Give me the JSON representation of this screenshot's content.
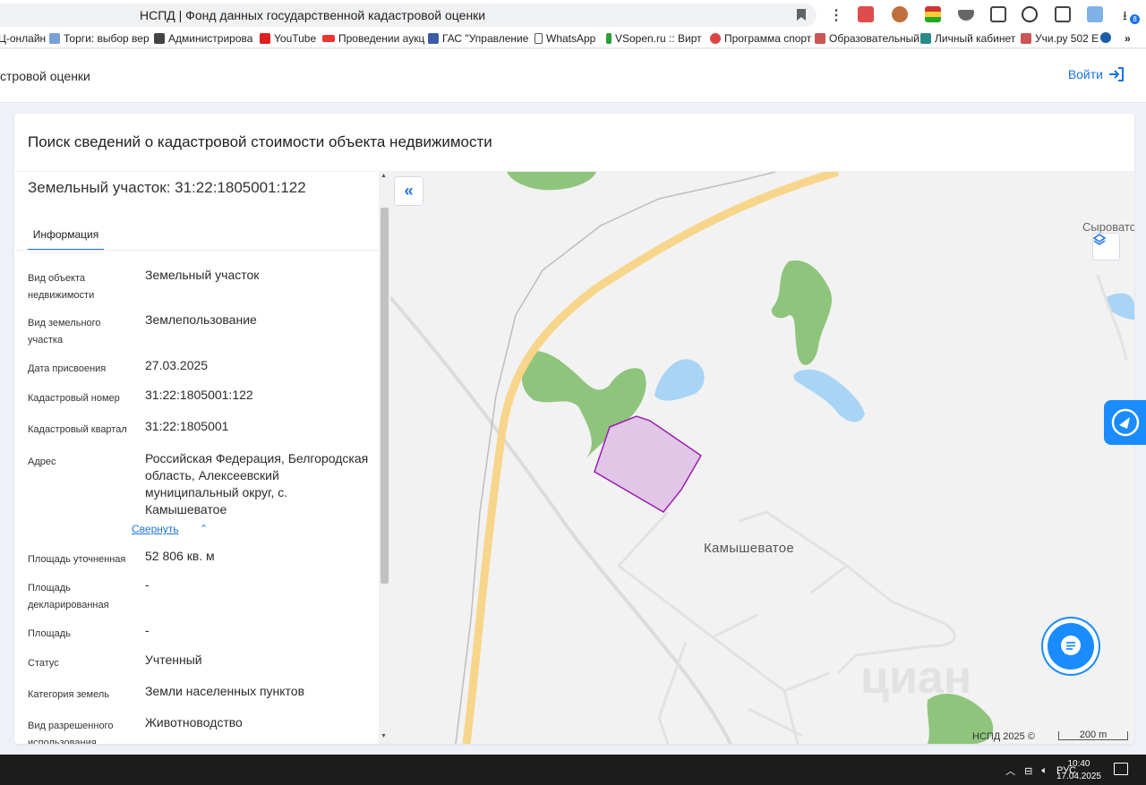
{
  "browser": {
    "tab_title": "НСПД | Фонд данных государственной кадастровой оценки",
    "bookmarks": [
      "Ц-онлайн",
      "Торги: выбор вер",
      "Администрирова",
      "YouTube",
      "Проведении аукц",
      "ГАС \"Управление",
      "WhatsApp",
      "VSopen.ru :: Вирт",
      "Программа спорт",
      "Образовательный",
      "Личный кабинет",
      "Учи.ру 502 Е"
    ],
    "more": "»",
    "extension_badge": "8"
  },
  "header": {
    "site_title": "стровой оценки",
    "login_label": "Войти"
  },
  "card": {
    "title": "Поиск сведений о кадастровой стоимости объекта недвижимости"
  },
  "object": {
    "title": "Земельный участок: 31:22:1805001:122",
    "tab_label": "Информация",
    "fields": [
      {
        "label": "Вид объекта недвижимости",
        "value": "Земельный участок"
      },
      {
        "label": "Вид земельного участка",
        "value": "Землепользование"
      },
      {
        "label": "Дата присвоения",
        "value": "27.03.2025"
      },
      {
        "label": "Кадастровый номер",
        "value": "31:22:1805001:122"
      },
      {
        "label": "Кадастровый квартал",
        "value": "31:22:1805001"
      },
      {
        "label": "Адрес",
        "value": "Российская Федерация, Белгородская область, Алексеевский муниципальный округ, с. Камышеватое"
      },
      {
        "label": "Площадь уточненная",
        "value": "52 806 кв. м"
      },
      {
        "label": "Площадь декларированная",
        "value": "-"
      },
      {
        "label": "Площадь",
        "value": "-"
      },
      {
        "label": "Статус",
        "value": "Учтенный"
      },
      {
        "label": "Категория земель",
        "value": "Земли населенных пунктов"
      },
      {
        "label": "Вид разрешенного использования",
        "value": "Животноводство"
      }
    ],
    "collapse_label": "Свернуть"
  },
  "map": {
    "village_label": "Камышеватое",
    "edge_label": "Сыровато",
    "credit": "НСПД 2025 ©",
    "scale": "200 m",
    "watermark": "циан",
    "parcel_color": "#e2c6e8",
    "parcel_stroke": "#9b1fae"
  },
  "taskbar": {
    "language": "РУС",
    "time": "10:40",
    "date": "17.04.2025"
  }
}
